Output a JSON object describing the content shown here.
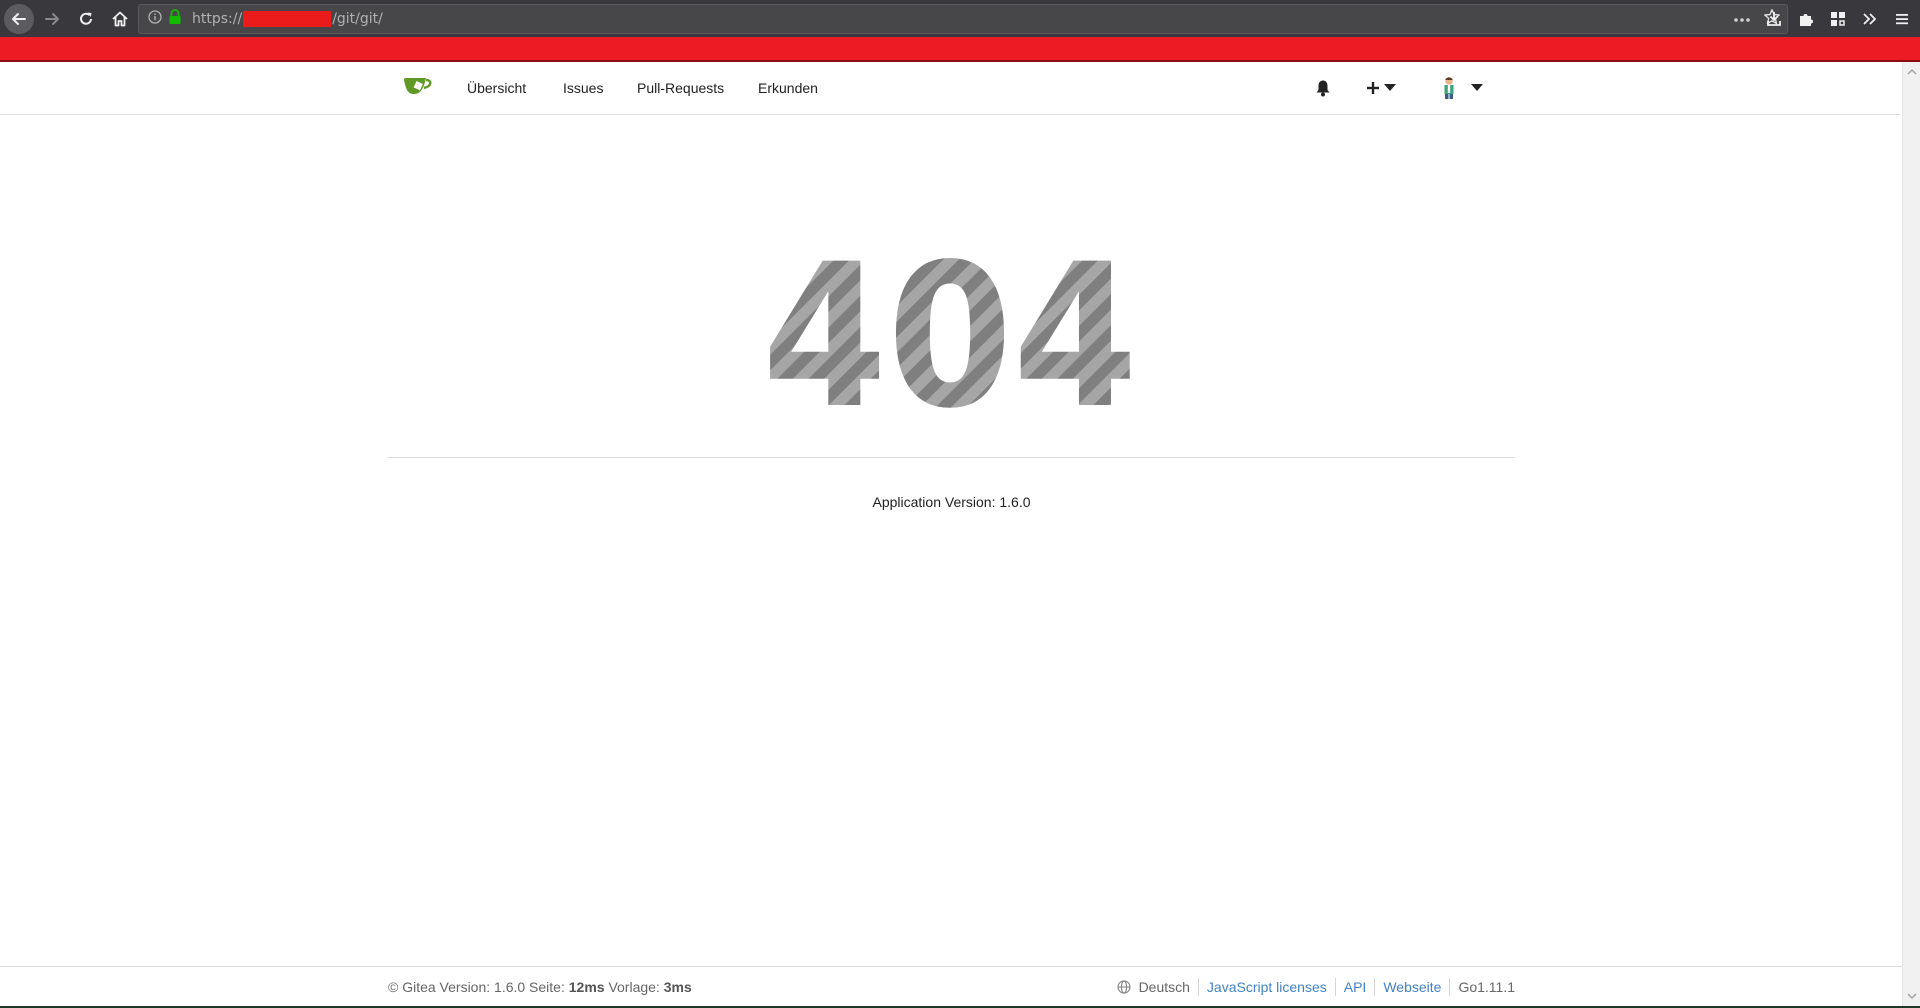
{
  "browser": {
    "url_prefix": "https://",
    "url_suffix": "/git/git/"
  },
  "nav": {
    "items": [
      "Übersicht",
      "Issues",
      "Pull-Requests",
      "Erkunden"
    ]
  },
  "error": {
    "code": "404",
    "app_version": "Application Version: 1.6.0"
  },
  "footer": {
    "copyright": "© Gitea Version: 1.6.0 Seite: ",
    "page_time": "12ms",
    "template_label": " Vorlage: ",
    "template_time": "3ms",
    "language": "Deutsch",
    "links": [
      "JavaScript licenses",
      "API",
      "Webseite"
    ],
    "go_version": "Go1.11.1"
  },
  "colors": {
    "accent_red": "#ec1c24",
    "gitea_green": "#609926",
    "link_blue": "#4183c4"
  },
  "icons": {
    "back": "arrow-left-icon",
    "forward": "arrow-right-icon",
    "reload": "reload-icon",
    "home": "home-icon",
    "info": "info-icon",
    "lock": "lock-icon",
    "page_actions": "ellipsis-icon",
    "bookmark": "star-icon",
    "downloads": "download-icon",
    "extensions": "puzzle-icon",
    "sidebar": "sidebar-icon",
    "overflow": "chevrons-icon",
    "menu": "hamburger-icon",
    "notifications": "bell-icon",
    "create": "plus-icon",
    "avatar": "avatar-icon",
    "language": "globe-icon"
  }
}
